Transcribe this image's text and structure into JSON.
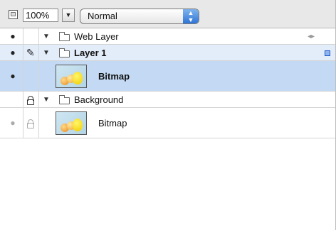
{
  "toolbar": {
    "opacity_value": "100%",
    "opacity_dropdown_arrow": "▼",
    "blend_mode": "Normal",
    "icons": [
      "layer-options-icon",
      "up-down-arrows-icon"
    ]
  },
  "layers": {
    "web_layer": {
      "name": "Web Layer",
      "icons": [
        "eye-icon",
        "disclosure-triangle-icon",
        "folder-icon",
        "web-layer-icon"
      ]
    },
    "layer1": {
      "name": "Layer 1",
      "icons": [
        "eye-icon",
        "pencil-icon",
        "disclosure-triangle-icon",
        "folder-icon",
        "selection-indicator-icon"
      ]
    },
    "layer1_bitmap": {
      "name": "Bitmap",
      "icons": [
        "eye-icon",
        "bitmap-thumbnail"
      ]
    },
    "background": {
      "name": "Background",
      "icons": [
        "lock-icon",
        "disclosure-triangle-icon",
        "folder-icon"
      ]
    },
    "background_bitmap": {
      "name": "Bitmap",
      "icons": [
        "eye-icon",
        "lock-icon",
        "bitmap-thumbnail"
      ]
    }
  },
  "colors": {
    "selected_row": "#c3d9f4",
    "active_layer_row": "#e3ecf9",
    "blend_arrows": "#2f74d6"
  }
}
